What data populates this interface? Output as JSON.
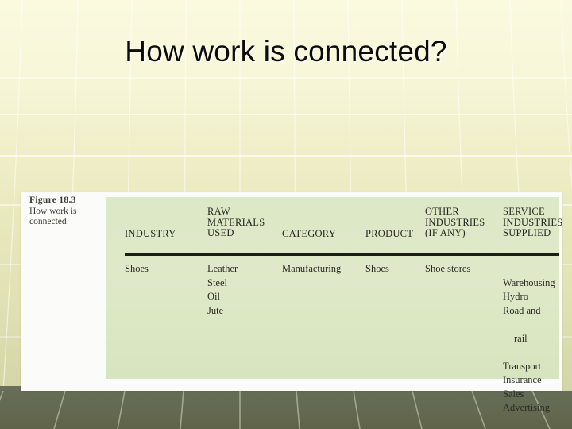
{
  "slide": {
    "title": "How work is connected?",
    "background_color": "#f0efc9",
    "band_color": "#63684f"
  },
  "figure": {
    "caption_title": "Figure 18.3",
    "caption_text": "How work is\nconnected",
    "panel_color": "#dce8c6"
  },
  "table": {
    "headers": [
      "INDUSTRY",
      "RAW\nMATERIALS\nUSED",
      "CATEGORY",
      "PRODUCT",
      "OTHER\nINDUSTRIES\n(IF ANY)",
      "SERVICE\nINDUSTRIES\nSUPPLIED"
    ],
    "rows": [
      {
        "industry": "Shoes",
        "raw_materials_used": "Leather\nSteel\nOil\nJute",
        "category": "Manufacturing",
        "product": "Shoes",
        "other_industries": "Shoe stores",
        "service_industries_supplied_top": "Warehousing\nHydro\nRoad and",
        "service_industries_supplied_indent": "rail",
        "service_industries_supplied_rest": "Transport\nInsurance\nSales\nAdvertising"
      }
    ]
  }
}
